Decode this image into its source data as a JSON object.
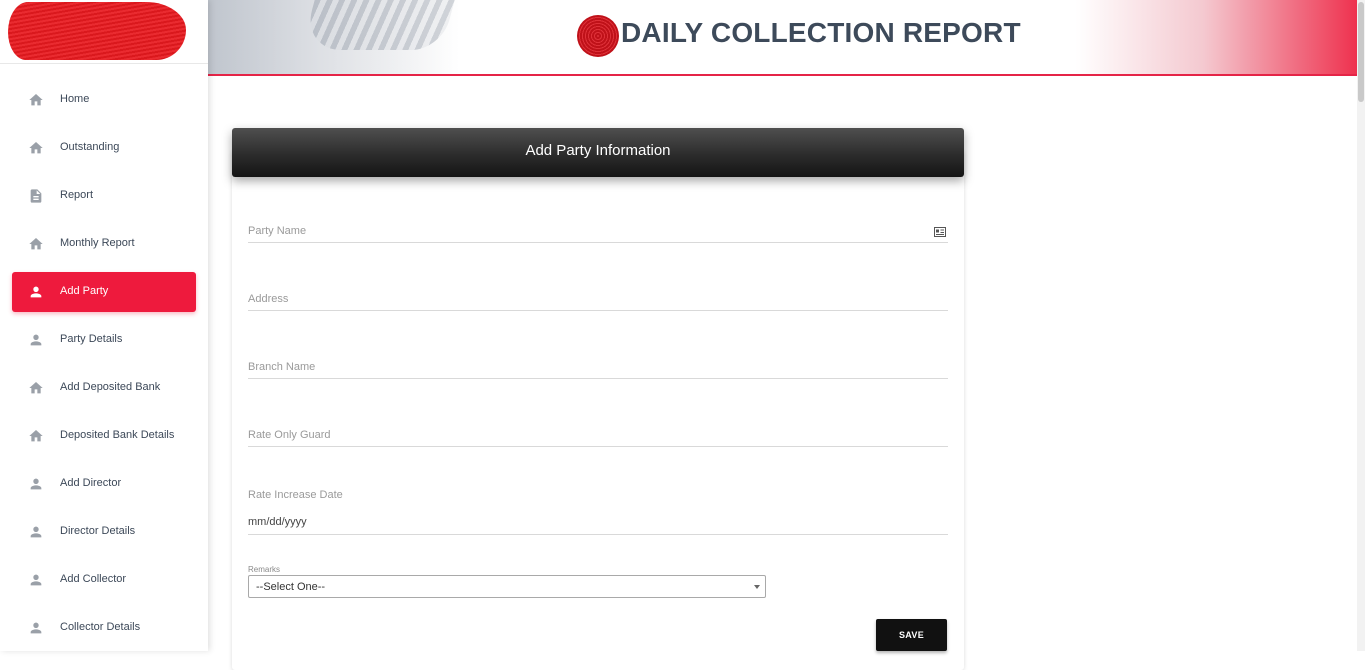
{
  "header": {
    "title": "DAILY COLLECTION REPORT"
  },
  "sidebar": {
    "items": [
      {
        "label": "Home",
        "icon": "home-icon"
      },
      {
        "label": "Outstanding",
        "icon": "home-icon"
      },
      {
        "label": "Report",
        "icon": "document-icon"
      },
      {
        "label": "Monthly Report",
        "icon": "home-icon"
      },
      {
        "label": "Add Party",
        "icon": "person-icon",
        "active": true
      },
      {
        "label": "Party Details",
        "icon": "person-icon"
      },
      {
        "label": "Add Deposited Bank",
        "icon": "home-icon"
      },
      {
        "label": "Deposited Bank Details",
        "icon": "home-icon"
      },
      {
        "label": "Add Director",
        "icon": "person-icon"
      },
      {
        "label": "Director Details",
        "icon": "person-icon"
      },
      {
        "label": "Add Collector",
        "icon": "person-icon"
      },
      {
        "label": "Collector Details",
        "icon": "person-icon"
      }
    ]
  },
  "form": {
    "title": "Add Party Information",
    "party_name_label": "Party Name",
    "address_label": "Address",
    "branch_name_label": "Branch Name",
    "rate_only_guard_label": "Rate Only Guard",
    "rate_increase_date_label": "Rate Increase Date",
    "rate_increase_date_value": "mm/dd/yyyy",
    "remarks_label": "Remarks",
    "remarks_selected": "--Select One--",
    "save_label": "SAVE"
  },
  "colors": {
    "accent": "#ee1a3d",
    "header_title": "#3d4a5a",
    "card_header": "#2c2c2c"
  }
}
